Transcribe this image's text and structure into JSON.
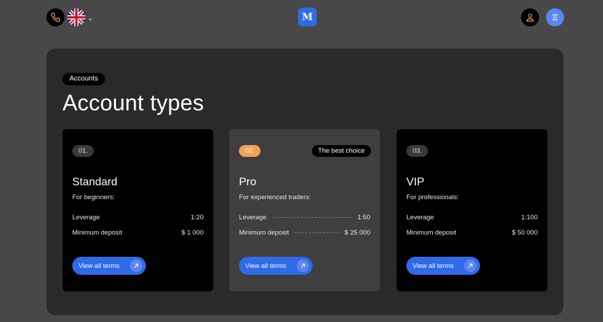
{
  "header": {
    "logo_letter": "M",
    "icons": {
      "phone": "phone-icon",
      "language": "uk-flag-icon",
      "caret": "chevron-down-icon",
      "user": "user-icon",
      "menu": "menu-icon"
    },
    "colors": {
      "accent": "#2f6be8",
      "accent_light": "#5d86f0",
      "phone_icon": "#f1a259"
    }
  },
  "main": {
    "breadcrumb": "Accounts",
    "title": "Account types",
    "cards": [
      {
        "number": "01.",
        "name": "Standard",
        "subtitle": "For beginners:",
        "leverage_label": "Leverage",
        "leverage_value": "1:20",
        "deposit_label": "Minimum deposit",
        "deposit_value": "$ 1 000",
        "button_label": "View all terms"
      },
      {
        "number": "02.",
        "badge": "The best choice",
        "name": "Pro",
        "subtitle": "For experienced traders:",
        "leverage_label": "Leverage",
        "leverage_value": "1:50",
        "deposit_label": "Minimum deposit",
        "deposit_value": "$ 25 000",
        "button_label": "View all terms"
      },
      {
        "number": "03.",
        "name": "VIP",
        "subtitle": "For professionals:",
        "leverage_label": "Leverage",
        "leverage_value": "1:100",
        "deposit_label": "Minimum deposit",
        "deposit_value": "$ 50 000",
        "button_label": "View all terms"
      }
    ]
  }
}
